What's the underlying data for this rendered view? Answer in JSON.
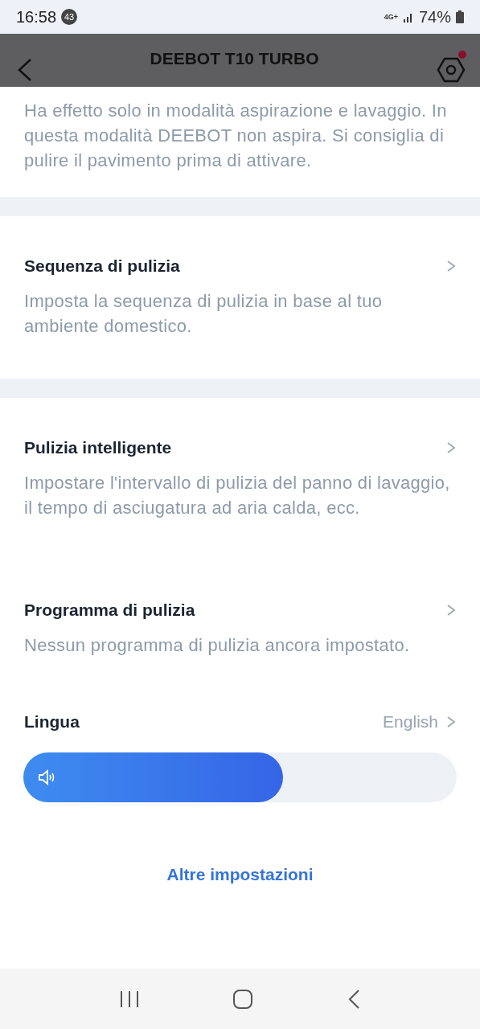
{
  "status_bar": {
    "time": "16:58",
    "notification_count": "43",
    "network": "4G+",
    "battery": "74%"
  },
  "header": {
    "title": "DEEBOT T10 TURBO",
    "settings_badge": true
  },
  "intro_text": "Ha effetto solo in modalità aspirazione e lavaggio. In questa modalità DEEBOT non aspira. Si consiglia di pulire il pavimento prima di attivare.",
  "sections": [
    {
      "items": [
        {
          "title": "Sequenza di pulizia",
          "description": "Imposta la sequenza di pulizia in base al tuo ambiente domestico."
        }
      ]
    },
    {
      "items": [
        {
          "title": "Pulizia intelligente",
          "description": "Impostare l'intervallo di pulizia del panno di lavaggio, il tempo di asciugatura ad aria calda, ecc."
        },
        {
          "title": "Programma di pulizia",
          "description": "Nessun programma di pulizia ancora impostato."
        }
      ],
      "language": {
        "label": "Lingua",
        "value": "English"
      },
      "volume": {
        "level": 0.6
      },
      "more_link": "Altre impostazioni"
    }
  ]
}
